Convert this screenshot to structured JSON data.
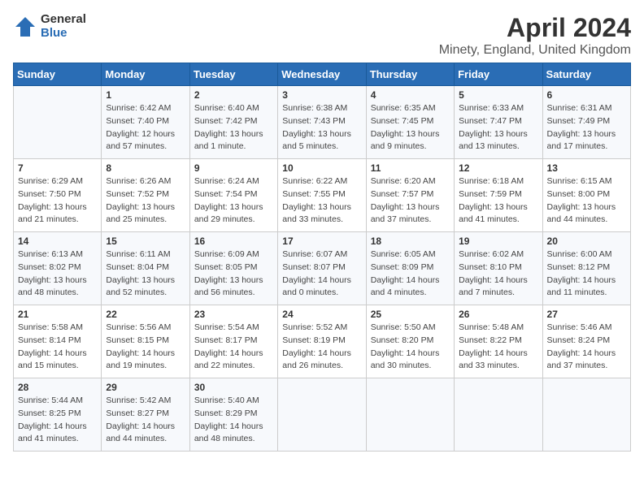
{
  "logo": {
    "general": "General",
    "blue": "Blue"
  },
  "title": {
    "month_year": "April 2024",
    "location": "Minety, England, United Kingdom"
  },
  "weekdays": [
    "Sunday",
    "Monday",
    "Tuesday",
    "Wednesday",
    "Thursday",
    "Friday",
    "Saturday"
  ],
  "weeks": [
    [
      {
        "day": "",
        "info": ""
      },
      {
        "day": "1",
        "info": "Sunrise: 6:42 AM\nSunset: 7:40 PM\nDaylight: 12 hours\nand 57 minutes."
      },
      {
        "day": "2",
        "info": "Sunrise: 6:40 AM\nSunset: 7:42 PM\nDaylight: 13 hours\nand 1 minute."
      },
      {
        "day": "3",
        "info": "Sunrise: 6:38 AM\nSunset: 7:43 PM\nDaylight: 13 hours\nand 5 minutes."
      },
      {
        "day": "4",
        "info": "Sunrise: 6:35 AM\nSunset: 7:45 PM\nDaylight: 13 hours\nand 9 minutes."
      },
      {
        "day": "5",
        "info": "Sunrise: 6:33 AM\nSunset: 7:47 PM\nDaylight: 13 hours\nand 13 minutes."
      },
      {
        "day": "6",
        "info": "Sunrise: 6:31 AM\nSunset: 7:49 PM\nDaylight: 13 hours\nand 17 minutes."
      }
    ],
    [
      {
        "day": "7",
        "info": "Sunrise: 6:29 AM\nSunset: 7:50 PM\nDaylight: 13 hours\nand 21 minutes."
      },
      {
        "day": "8",
        "info": "Sunrise: 6:26 AM\nSunset: 7:52 PM\nDaylight: 13 hours\nand 25 minutes."
      },
      {
        "day": "9",
        "info": "Sunrise: 6:24 AM\nSunset: 7:54 PM\nDaylight: 13 hours\nand 29 minutes."
      },
      {
        "day": "10",
        "info": "Sunrise: 6:22 AM\nSunset: 7:55 PM\nDaylight: 13 hours\nand 33 minutes."
      },
      {
        "day": "11",
        "info": "Sunrise: 6:20 AM\nSunset: 7:57 PM\nDaylight: 13 hours\nand 37 minutes."
      },
      {
        "day": "12",
        "info": "Sunrise: 6:18 AM\nSunset: 7:59 PM\nDaylight: 13 hours\nand 41 minutes."
      },
      {
        "day": "13",
        "info": "Sunrise: 6:15 AM\nSunset: 8:00 PM\nDaylight: 13 hours\nand 44 minutes."
      }
    ],
    [
      {
        "day": "14",
        "info": "Sunrise: 6:13 AM\nSunset: 8:02 PM\nDaylight: 13 hours\nand 48 minutes."
      },
      {
        "day": "15",
        "info": "Sunrise: 6:11 AM\nSunset: 8:04 PM\nDaylight: 13 hours\nand 52 minutes."
      },
      {
        "day": "16",
        "info": "Sunrise: 6:09 AM\nSunset: 8:05 PM\nDaylight: 13 hours\nand 56 minutes."
      },
      {
        "day": "17",
        "info": "Sunrise: 6:07 AM\nSunset: 8:07 PM\nDaylight: 14 hours\nand 0 minutes."
      },
      {
        "day": "18",
        "info": "Sunrise: 6:05 AM\nSunset: 8:09 PM\nDaylight: 14 hours\nand 4 minutes."
      },
      {
        "day": "19",
        "info": "Sunrise: 6:02 AM\nSunset: 8:10 PM\nDaylight: 14 hours\nand 7 minutes."
      },
      {
        "day": "20",
        "info": "Sunrise: 6:00 AM\nSunset: 8:12 PM\nDaylight: 14 hours\nand 11 minutes."
      }
    ],
    [
      {
        "day": "21",
        "info": "Sunrise: 5:58 AM\nSunset: 8:14 PM\nDaylight: 14 hours\nand 15 minutes."
      },
      {
        "day": "22",
        "info": "Sunrise: 5:56 AM\nSunset: 8:15 PM\nDaylight: 14 hours\nand 19 minutes."
      },
      {
        "day": "23",
        "info": "Sunrise: 5:54 AM\nSunset: 8:17 PM\nDaylight: 14 hours\nand 22 minutes."
      },
      {
        "day": "24",
        "info": "Sunrise: 5:52 AM\nSunset: 8:19 PM\nDaylight: 14 hours\nand 26 minutes."
      },
      {
        "day": "25",
        "info": "Sunrise: 5:50 AM\nSunset: 8:20 PM\nDaylight: 14 hours\nand 30 minutes."
      },
      {
        "day": "26",
        "info": "Sunrise: 5:48 AM\nSunset: 8:22 PM\nDaylight: 14 hours\nand 33 minutes."
      },
      {
        "day": "27",
        "info": "Sunrise: 5:46 AM\nSunset: 8:24 PM\nDaylight: 14 hours\nand 37 minutes."
      }
    ],
    [
      {
        "day": "28",
        "info": "Sunrise: 5:44 AM\nSunset: 8:25 PM\nDaylight: 14 hours\nand 41 minutes."
      },
      {
        "day": "29",
        "info": "Sunrise: 5:42 AM\nSunset: 8:27 PM\nDaylight: 14 hours\nand 44 minutes."
      },
      {
        "day": "30",
        "info": "Sunrise: 5:40 AM\nSunset: 8:29 PM\nDaylight: 14 hours\nand 48 minutes."
      },
      {
        "day": "",
        "info": ""
      },
      {
        "day": "",
        "info": ""
      },
      {
        "day": "",
        "info": ""
      },
      {
        "day": "",
        "info": ""
      }
    ]
  ]
}
